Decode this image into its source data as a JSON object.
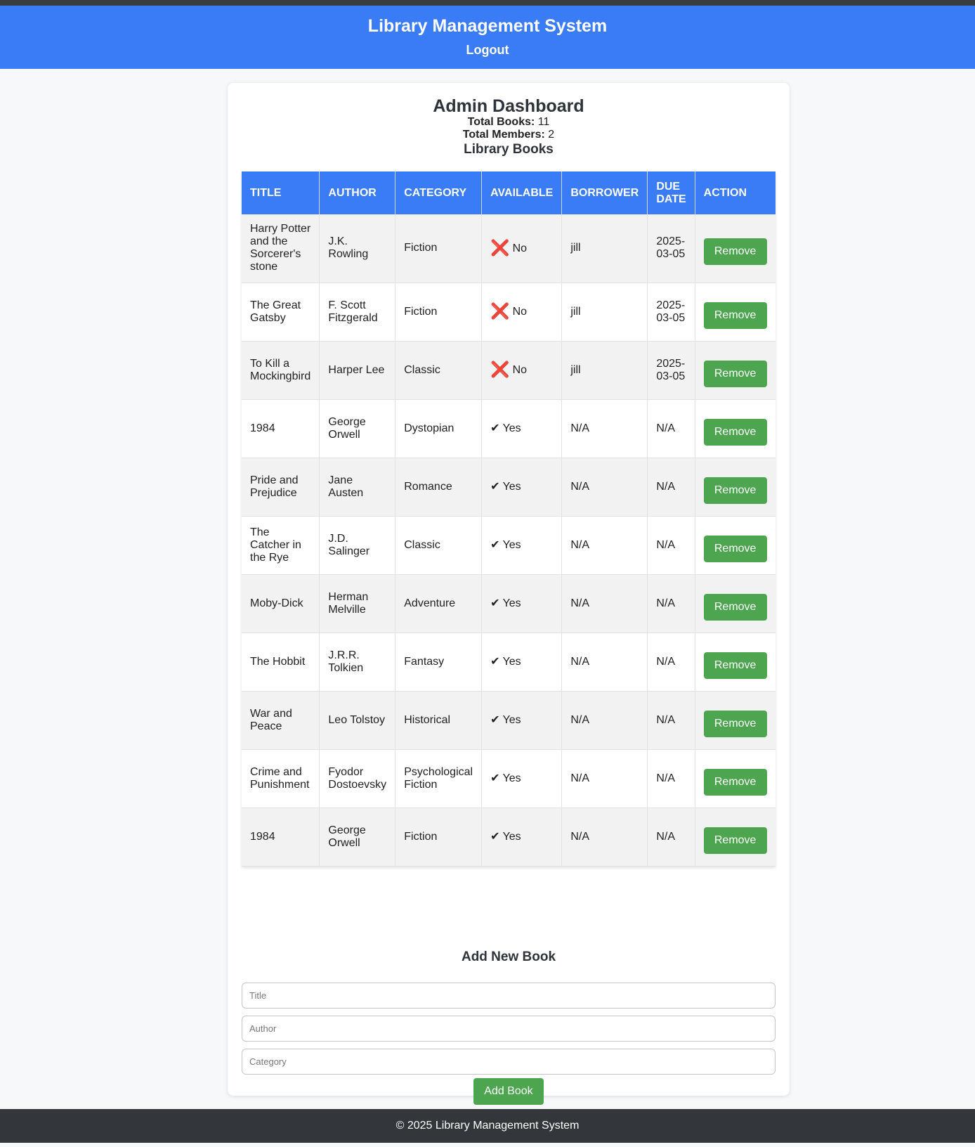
{
  "header": {
    "title": "Library Management System",
    "logout_label": "Logout"
  },
  "dashboard": {
    "title": "Admin Dashboard",
    "total_books_label": "Total Books:",
    "total_books_value": "11",
    "total_members_label": "Total Members:",
    "total_members_value": "2",
    "books_heading": "Library Books"
  },
  "table": {
    "headers": [
      "Title",
      "Author",
      "Category",
      "Available",
      "Borrower",
      "Due Date",
      "Action"
    ],
    "rows": [
      {
        "title": "Harry Potter and the Sorcerer's stone",
        "author": "J.K. Rowling",
        "category": "Fiction",
        "available": "No",
        "borrower": "jill",
        "due": "2025-03-05",
        "action": "Remove"
      },
      {
        "title": "The Great Gatsby",
        "author": "F. Scott Fitzgerald",
        "category": "Fiction",
        "available": "No",
        "borrower": "jill",
        "due": "2025-03-05",
        "action": "Remove"
      },
      {
        "title": "To Kill a Mockingbird",
        "author": "Harper Lee",
        "category": "Classic",
        "available": "No",
        "borrower": "jill",
        "due": "2025-03-05",
        "action": "Remove"
      },
      {
        "title": "1984",
        "author": "George Orwell",
        "category": "Dystopian",
        "available": "Yes",
        "borrower": "N/A",
        "due": "N/A",
        "action": "Remove"
      },
      {
        "title": "Pride and Prejudice",
        "author": "Jane Austen",
        "category": "Romance",
        "available": "Yes",
        "borrower": "N/A",
        "due": "N/A",
        "action": "Remove"
      },
      {
        "title": "The Catcher in the Rye",
        "author": "J.D. Salinger",
        "category": "Classic",
        "available": "Yes",
        "borrower": "N/A",
        "due": "N/A",
        "action": "Remove"
      },
      {
        "title": "Moby-Dick",
        "author": "Herman Melville",
        "category": "Adventure",
        "available": "Yes",
        "borrower": "N/A",
        "due": "N/A",
        "action": "Remove"
      },
      {
        "title": "The Hobbit",
        "author": "J.R.R. Tolkien",
        "category": "Fantasy",
        "available": "Yes",
        "borrower": "N/A",
        "due": "N/A",
        "action": "Remove"
      },
      {
        "title": "War and Peace",
        "author": "Leo Tolstoy",
        "category": "Historical",
        "available": "Yes",
        "borrower": "N/A",
        "due": "N/A",
        "action": "Remove"
      },
      {
        "title": "Crime and Punishment",
        "author": "Fyodor Dostoevsky",
        "category": "Psychological Fiction",
        "available": "Yes",
        "borrower": "N/A",
        "due": "N/A",
        "action": "Remove"
      },
      {
        "title": "1984",
        "author": "George Orwell",
        "category": "Fiction",
        "available": "Yes",
        "borrower": "N/A",
        "due": "N/A",
        "action": "Remove"
      }
    ]
  },
  "icons": {
    "unavailable": "cross-mark-icon",
    "available": "check-mark-icon"
  },
  "add_form": {
    "heading": "Add New Book",
    "title_placeholder": "Title",
    "author_placeholder": "Author",
    "category_placeholder": "Category",
    "submit_label": "Add Book"
  },
  "footer": {
    "text": "© 2025 Library Management System"
  },
  "colors": {
    "primary": "#3a7bf6",
    "button_green": "#4da54f",
    "footer_bg": "#33373b",
    "no_red": "#d9302c"
  }
}
